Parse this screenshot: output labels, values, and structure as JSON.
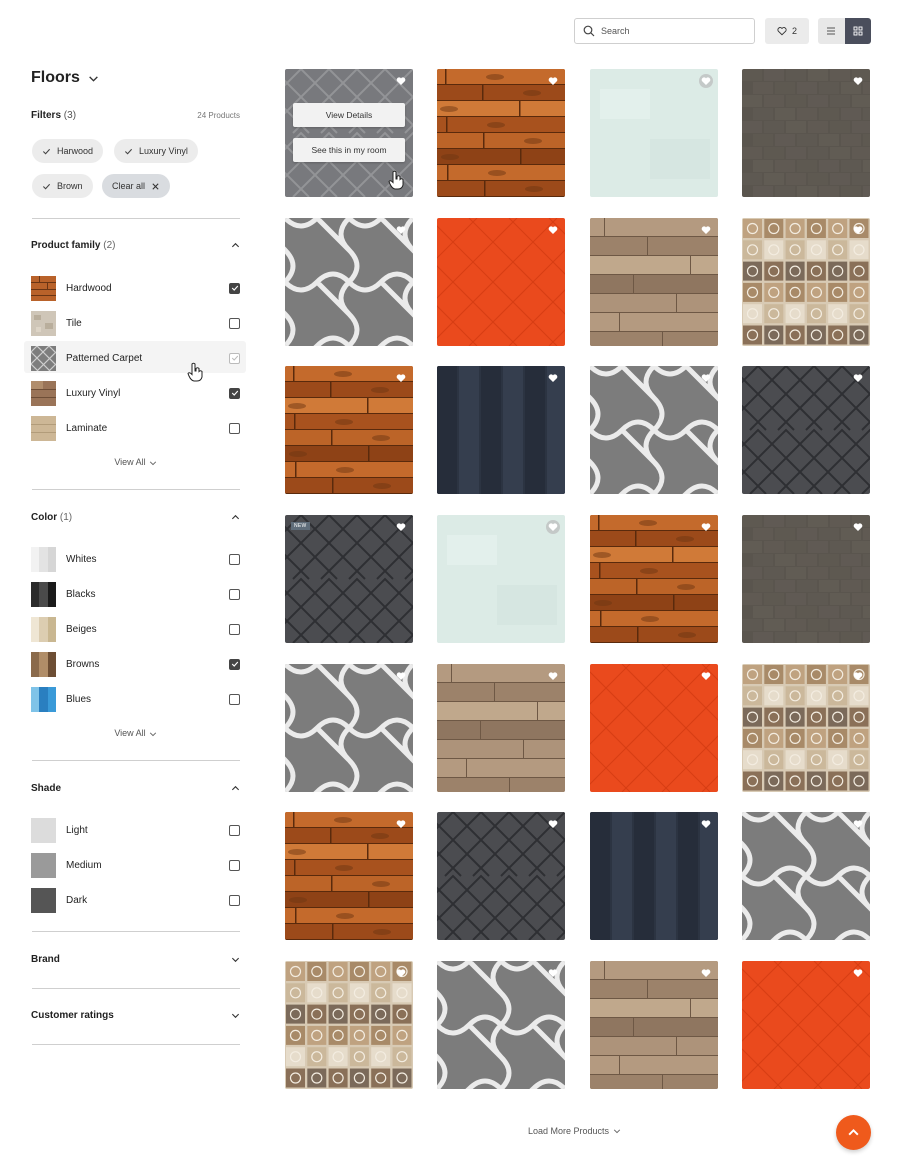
{
  "header": {
    "search_placeholder": "Search",
    "wishlist_count": "2"
  },
  "sidebar": {
    "title": "Floors",
    "filters_label": "Filters",
    "filters_count": "(3)",
    "products_count": "24 Products",
    "chips": [
      "Harwood",
      "Luxury Vinyl",
      "Brown"
    ],
    "clear_all": "Clear all",
    "product_family": {
      "title": "Product family",
      "count": "(2)",
      "items": [
        {
          "label": "Hardwood",
          "checked": true,
          "pattern": "wood"
        },
        {
          "label": "Tile",
          "checked": false,
          "pattern": "stone"
        },
        {
          "label": "Patterned Carpet",
          "checked": false,
          "pattern": "carpet"
        },
        {
          "label": "Luxury Vinyl",
          "checked": true,
          "pattern": "vinyl"
        },
        {
          "label": "Laminate",
          "checked": false,
          "pattern": "laminate"
        }
      ],
      "view_all": "View All"
    },
    "color": {
      "title": "Color",
      "count": "(1)",
      "items": [
        {
          "label": "Whites",
          "checked": false,
          "colors": [
            "#f2f2f2",
            "#e3e3e3",
            "#d6d6d6"
          ]
        },
        {
          "label": "Blacks",
          "checked": false,
          "colors": [
            "#2b2b2b",
            "#4a4a4a",
            "#1a1a1a"
          ]
        },
        {
          "label": "Beiges",
          "checked": false,
          "colors": [
            "#efe6d4",
            "#dccdb1",
            "#c9b791"
          ]
        },
        {
          "label": "Browns",
          "checked": true,
          "colors": [
            "#8a6a4b",
            "#b08d68",
            "#6d4e34"
          ]
        },
        {
          "label": "Blues",
          "checked": false,
          "colors": [
            "#7fc3e8",
            "#2a7fc0",
            "#3a9ad8"
          ]
        }
      ],
      "view_all": "View All"
    },
    "shade": {
      "title": "Shade",
      "items": [
        {
          "label": "Light",
          "checked": false,
          "color": "#dcdcdc"
        },
        {
          "label": "Medium",
          "checked": false,
          "color": "#9a9a9a"
        },
        {
          "label": "Dark",
          "checked": false,
          "color": "#555555"
        }
      ]
    },
    "brand": {
      "title": "Brand"
    },
    "customer_ratings": {
      "title": "Customer ratings"
    }
  },
  "grid": {
    "overlay": {
      "view_details": "View Details",
      "see_in_room": "See this in my room"
    },
    "new_badge": "NEW",
    "tiles": [
      "herringbone-gray",
      "wood-orange",
      "mint",
      "brown-gray",
      "carpet",
      "red",
      "wood-light",
      "mosaic",
      "wood-orange",
      "navy",
      "carpet",
      "herringbone-dark",
      "herringbone-dark",
      "mint",
      "wood-orange",
      "brown-gray",
      "carpet",
      "wood-light",
      "red",
      "mosaic",
      "wood-orange",
      "herringbone-dark",
      "navy",
      "carpet",
      "mosaic",
      "carpet",
      "wood-light",
      "red"
    ]
  },
  "footer": {
    "load_more": "Load More Products"
  },
  "colors": {
    "accent": "#ef5a1c",
    "grid_toggle": "#4a4e5c"
  }
}
